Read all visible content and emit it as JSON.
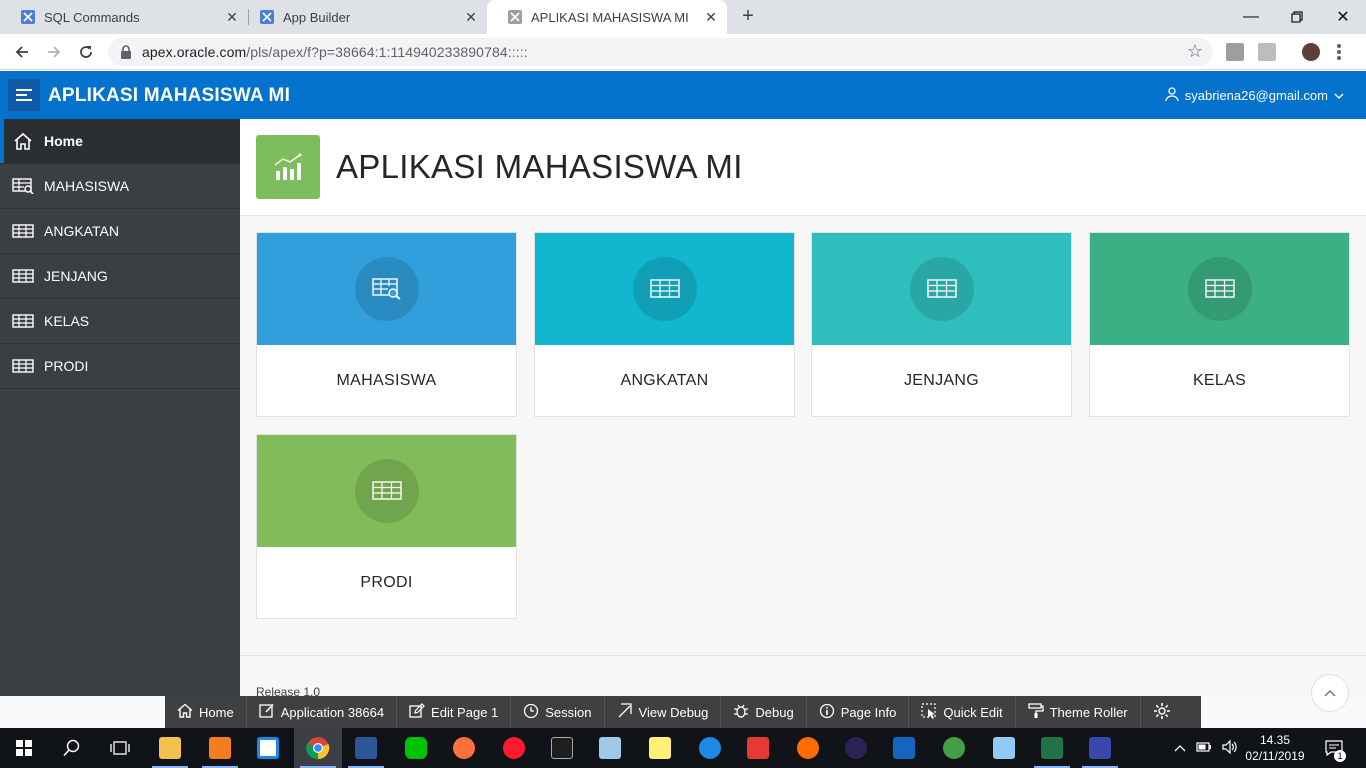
{
  "browser": {
    "tabs": [
      {
        "title": "SQL Commands",
        "active": false
      },
      {
        "title": "App Builder",
        "active": false
      },
      {
        "title": "APLIKASI MAHASISWA MI",
        "active": true
      }
    ],
    "url_host": "apex.oracle.com",
    "url_path": "/pls/apex/f?p=38664:1:114940233890784:::::"
  },
  "header": {
    "app_title": "APLIKASI MAHASISWA MI",
    "user": "syabriena26@gmail.com"
  },
  "sidebar": {
    "items": [
      {
        "label": "Home",
        "icon": "home-icon",
        "current": true
      },
      {
        "label": "MAHASISWA",
        "icon": "table-search-icon",
        "current": false
      },
      {
        "label": "ANGKATAN",
        "icon": "table-icon",
        "current": false
      },
      {
        "label": "JENJANG",
        "icon": "table-icon",
        "current": false
      },
      {
        "label": "KELAS",
        "icon": "table-icon",
        "current": false
      },
      {
        "label": "PRODI",
        "icon": "table-icon",
        "current": false
      }
    ]
  },
  "main": {
    "page_title": "APLIKASI MAHASISWA MI",
    "hero_icon": "chart-icon",
    "hero_color": "#7dbd5d",
    "cards": [
      {
        "label": "MAHASISWA",
        "icon": "table-search-icon",
        "color": "#309fdb"
      },
      {
        "label": "ANGKATAN",
        "icon": "table-icon",
        "color": "#13b6cf"
      },
      {
        "label": "JENJANG",
        "icon": "table-icon",
        "color": "#2ebfbc"
      },
      {
        "label": "KELAS",
        "icon": "table-icon",
        "color": "#3cb085"
      },
      {
        "label": "PRODI",
        "icon": "table-icon",
        "color": "#80bc59"
      }
    ],
    "release": "Release 1.0"
  },
  "devbar": {
    "items": [
      "Home",
      "Application 38664",
      "Edit Page 1",
      "Session",
      "View Debug",
      "Debug",
      "Page Info",
      "Quick Edit",
      "Theme Roller"
    ]
  },
  "taskbar": {
    "time": "14.35",
    "date": "02/11/2019",
    "notification_count": "1"
  },
  "colors": {
    "header": "#0572ce",
    "sidebar": "#3a3f44",
    "devbar": "#404040"
  }
}
